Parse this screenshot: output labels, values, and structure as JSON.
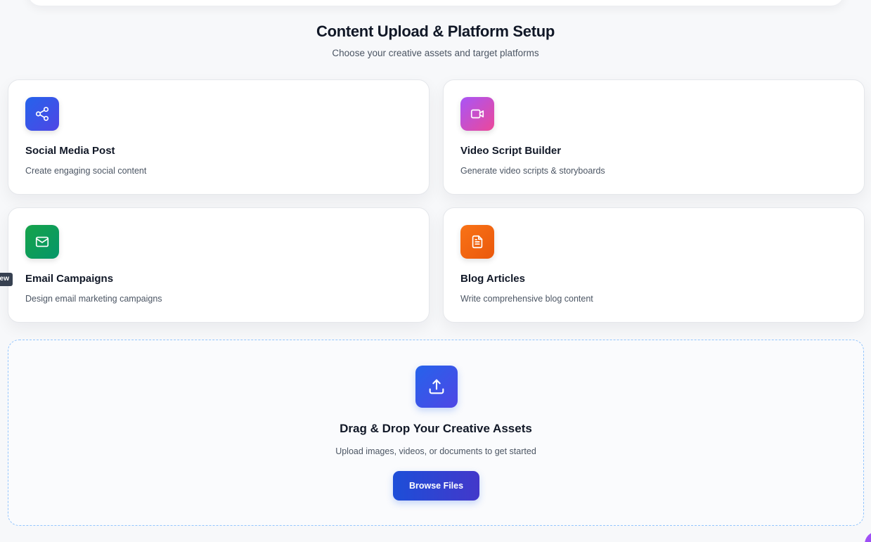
{
  "header": {
    "title": "Content Upload & Platform Setup",
    "subtitle": "Choose your creative assets and target platforms"
  },
  "cards": [
    {
      "title": "Social Media Post",
      "description": "Create engaging social content",
      "icon": "share-icon",
      "color": "#2563eb"
    },
    {
      "title": "Video Script Builder",
      "description": "Generate video scripts & storyboards",
      "icon": "video-camera-icon",
      "color": "#c026d3"
    },
    {
      "title": "Email Campaigns",
      "description": "Design email marketing campaigns",
      "icon": "mail-icon",
      "color": "#16a34a"
    },
    {
      "title": "Blog Articles",
      "description": "Write comprehensive blog content",
      "icon": "document-icon",
      "color": "#f97316"
    }
  ],
  "side_tooltip": {
    "label": "ew"
  },
  "dropzone": {
    "icon": "upload-icon",
    "title": "Drag & Drop Your Creative Assets",
    "subtitle": "Upload images, videos, or documents to get started",
    "button_label": "Browse Files",
    "accent": "#2563eb"
  }
}
